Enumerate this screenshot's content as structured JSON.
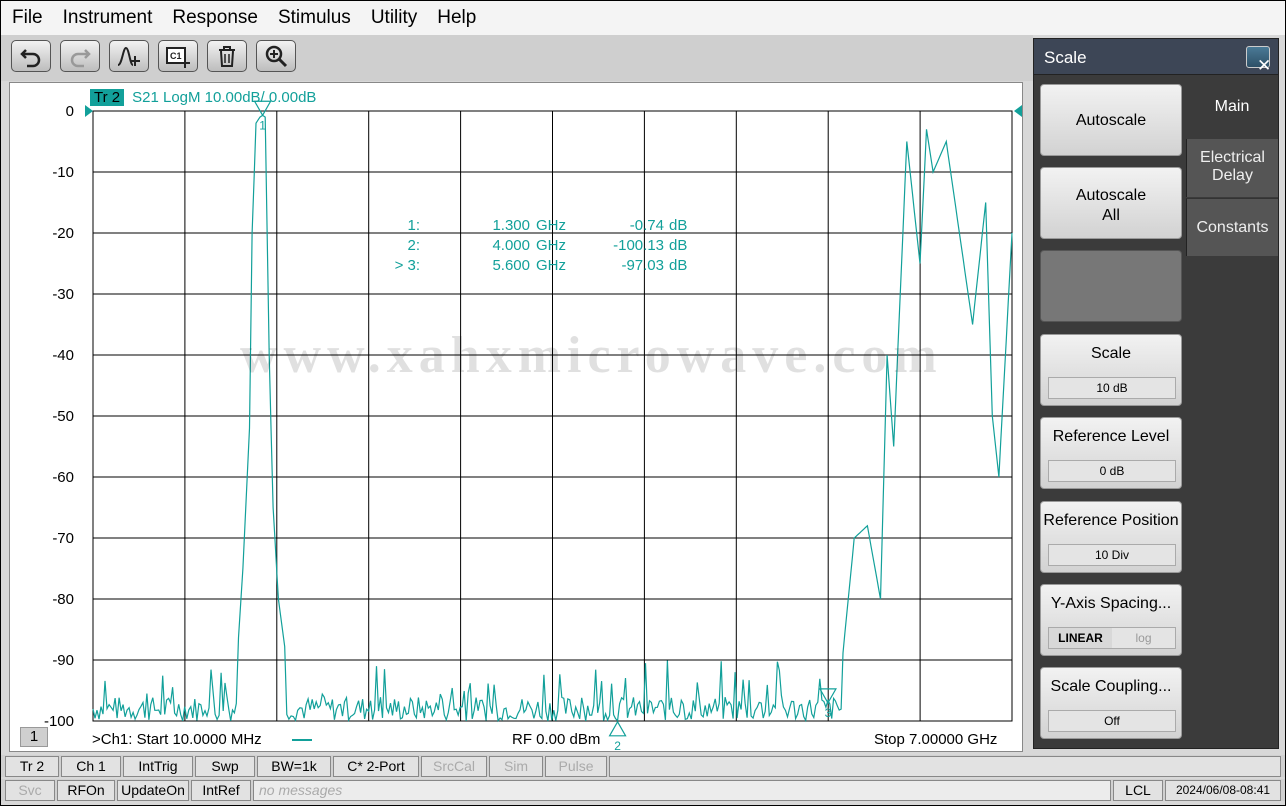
{
  "menu": [
    "File",
    "Instrument",
    "Response",
    "Stimulus",
    "Utility",
    "Help"
  ],
  "toolbar": {
    "icons": [
      "undo-icon",
      "redo-icon",
      "add-marker-icon",
      "add-channel-icon",
      "delete-icon",
      "zoom-icon"
    ]
  },
  "trace": {
    "tag": "Tr 2",
    "description": "S21 LogM 10.00dB/  0.00dB",
    "color": "#12a09a"
  },
  "markers": [
    {
      "id": "1:",
      "freq": "1.300",
      "unit": "GHz",
      "value": "-0.74",
      "value_unit": "dB"
    },
    {
      "id": "2:",
      "freq": "4.000",
      "unit": "GHz",
      "value": "-100.13",
      "value_unit": "dB"
    },
    {
      "id": "> 3:",
      "freq": "5.600",
      "unit": "GHz",
      "value": "-97.03",
      "value_unit": "dB"
    }
  ],
  "watermark": "www.xahxmicrowave.com",
  "footer": {
    "channel_number": "1",
    "start": ">Ch1:  Start   10.0000 MHz",
    "rf": "RF    0.00 dBm",
    "stop": "Stop  7.00000 GHz"
  },
  "chart_data": {
    "type": "line",
    "title": "",
    "xlabel": "",
    "ylabel": "",
    "xlim": [
      0.01,
      7.0
    ],
    "ylim": [
      -100,
      0
    ],
    "y_ticks": [
      "0",
      "-10",
      "-20",
      "-30",
      "-40",
      "-50",
      "-60",
      "-70",
      "-80",
      "-90",
      "-100"
    ],
    "x_divisions": 10,
    "grid": true,
    "marker_labels": [
      "1",
      "2",
      "3"
    ],
    "series": [
      {
        "x": [
          0.01,
          0.3,
          0.6,
          1.0,
          1.1,
          1.15,
          1.2,
          1.22,
          1.25,
          1.28,
          1.3,
          1.32,
          1.35,
          1.38,
          1.42,
          1.5,
          1.55,
          1.6,
          2.0,
          2.5,
          3.0,
          3.5,
          4.0,
          4.5,
          5.0,
          5.4,
          5.6,
          5.7,
          5.8,
          5.9,
          6.0,
          6.05,
          6.1,
          6.2,
          6.3,
          6.35,
          6.4,
          6.5,
          6.6,
          6.7,
          6.8,
          6.85,
          6.9,
          7.0
        ],
        "y": [
          -100,
          -99,
          -98,
          -97,
          -92,
          -75,
          -52,
          -20,
          -2,
          -1,
          -0.7,
          -1,
          -40,
          -65,
          -80,
          -93,
          -95,
          -99,
          -100,
          -99,
          -99,
          -100,
          -100.13,
          -99,
          -99,
          -98,
          -97.03,
          -92,
          -70,
          -68,
          -80,
          -40,
          -55,
          -5,
          -25,
          -3,
          -10,
          -5,
          -20,
          -35,
          -15,
          -50,
          -60,
          -20
        ]
      }
    ]
  },
  "side_panel": {
    "title": "Scale",
    "buttons": [
      {
        "label": "Autoscale",
        "value": ""
      },
      {
        "label": "Autoscale\nAll",
        "value": ""
      },
      {
        "label": "",
        "value": ""
      },
      {
        "label": "Scale",
        "value": "10 dB"
      },
      {
        "label": "Reference Level",
        "value": "0 dB"
      },
      {
        "label": "Reference Position",
        "value": "10 Div"
      },
      {
        "label": "Y-Axis Spacing...",
        "value": "LINEAR",
        "value_alt": "log"
      },
      {
        "label": "Scale Coupling...",
        "value": "Off"
      }
    ],
    "tabs": [
      "Main",
      "Electrical\nDelay",
      "Constants"
    ]
  },
  "status_bar_1": [
    "Tr 2",
    "Ch 1",
    "IntTrig",
    "Swp",
    "BW=1k",
    "C* 2-Port",
    "SrcCal",
    "Sim",
    "Pulse"
  ],
  "status_bar_2": [
    "Svc",
    "RFOn",
    "UpdateOn",
    "IntRef",
    "no messages",
    "LCL",
    "2024/06/08-08:41"
  ]
}
